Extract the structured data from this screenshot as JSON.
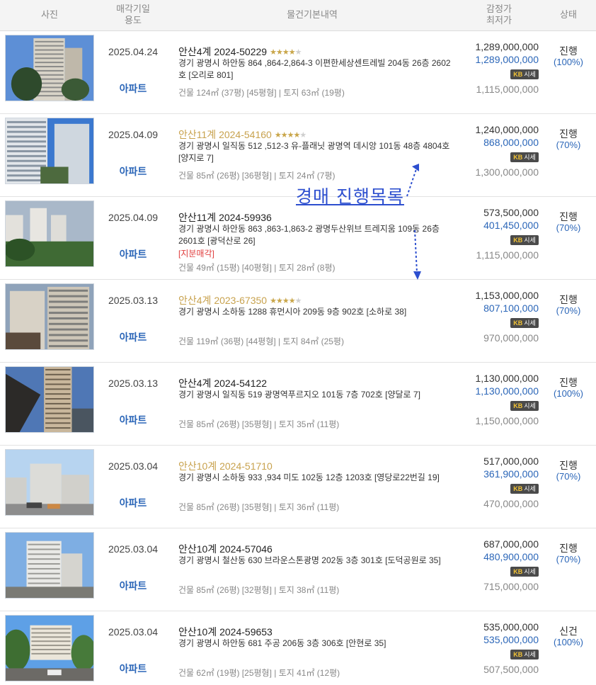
{
  "header": {
    "photo": "사진",
    "date_line1": "매각기일",
    "date_line2": "용도",
    "info": "물건기본내역",
    "price_line1": "감정가",
    "price_line2": "최저가",
    "status": "상태"
  },
  "overlay": {
    "text": "경매 진행목록",
    "color": "#2d4fcf"
  },
  "colors": {
    "gold_case": "#c8a24e",
    "blue": "#2b66b8",
    "header_bg": "#f4f4f4"
  },
  "badge": {
    "kb": "KB",
    "label": "시세"
  },
  "rows": [
    {
      "date": "2025.04.24",
      "use": "아파트",
      "case": "안산4계 2024-50229",
      "case_gold": false,
      "stars": 4,
      "addr": "경기 광명시 하안동 864 ,864-2,864-3 이편한세상센트레빌 204동 26층 2602호 [오리로 801]",
      "tag": "",
      "area": "건물 124㎡ (37평) [45평형]  |  토지 63㎡ (19평)",
      "appraisal": "1,289,000,000",
      "minimum": "1,289,000,000",
      "last": "1,115,000,000",
      "status": "진행",
      "percent": "(100%)",
      "photo": "tower-tall"
    },
    {
      "date": "2025.04.09",
      "use": "아파트",
      "case": "안산11계 2024-54160",
      "case_gold": true,
      "stars": 4,
      "addr": "경기 광명시 일직동 512 ,512-3 유-플래닛 광명역 데시앙 101동 48층 4804호 [양지로 7]",
      "tag": "",
      "area": "건물 85㎡ (26평) [36평형]  |  토지 24㎡ (7평)",
      "appraisal": "1,240,000,000",
      "minimum": "868,000,000",
      "last": "1,300,000,000",
      "status": "진행",
      "percent": "(70%)",
      "photo": "tower-blue"
    },
    {
      "date": "2025.04.09",
      "use": "아파트",
      "case": "안산11계 2024-59936",
      "case_gold": false,
      "stars": 0,
      "addr": "경기 광명시 하안동 863 ,863-1,863-2 광명두산위브 트레지움 109동 26층 2601호 [광덕산로 26]",
      "tag": "[지분매각]",
      "area": "건물 49㎡ (15평) [40평형]  |  토지 28㎡ (8평)",
      "appraisal": "573,500,000",
      "minimum": "401,450,000",
      "last": "1,115,000,000",
      "status": "진행",
      "percent": "(70%)",
      "photo": "green-complex"
    },
    {
      "date": "2025.03.13",
      "use": "아파트",
      "case": "안산4계 2023-67350",
      "case_gold": true,
      "stars": 4,
      "addr": "경기 광명시 소하동 1288 휴먼시아 209동 9층 902호 [소하로 38]",
      "tag": "",
      "area": "건물 119㎡ (36평) [44평형]  |  토지 84㎡ (25평)",
      "appraisal": "1,153,000,000",
      "minimum": "807,100,000",
      "last": "970,000,000",
      "status": "진행",
      "percent": "(70%)",
      "photo": "winter"
    },
    {
      "date": "2025.03.13",
      "use": "아파트",
      "case": "안산4계 2024-54122",
      "case_gold": false,
      "stars": 0,
      "addr": "경기 광명시 일직동 519 광명역푸르지오 101동 7층 702호 [양달로 7]",
      "tag": "",
      "area": "건물 85㎡ (26평) [35평형]  |  토지 35㎡ (11평)",
      "appraisal": "1,130,000,000",
      "minimum": "1,130,000,000",
      "last": "1,150,000,000",
      "status": "진행",
      "percent": "(100%)",
      "photo": "tower-dark"
    },
    {
      "date": "2025.03.04",
      "use": "아파트",
      "case": "안산10계 2024-51710",
      "case_gold": true,
      "stars": 0,
      "addr": "경기 광명시 소하동 933 ,934 미도 102동 12층 1203호 [영당로22번길 19]",
      "tag": "",
      "area": "건물 85㎡ (26평) [35평형]  |  토지 36㎡ (11평)",
      "appraisal": "517,000,000",
      "minimum": "361,900,000",
      "last": "470,000,000",
      "status": "진행",
      "percent": "(70%)",
      "photo": "street"
    },
    {
      "date": "2025.03.04",
      "use": "아파트",
      "case": "안산10계 2024-57046",
      "case_gold": false,
      "stars": 0,
      "addr": "경기 광명시 철산동 630 브라운스톤광명 202동 3층 301호 [도덕공원로 35]",
      "tag": "",
      "area": "건물 85㎡ (26평) [32평형]  |  토지 38㎡ (11평)",
      "appraisal": "687,000,000",
      "minimum": "480,900,000",
      "last": "715,000,000",
      "status": "진행",
      "percent": "(70%)",
      "photo": "tower-sky"
    },
    {
      "date": "2025.03.04",
      "use": "아파트",
      "case": "안산10계 2024-59653",
      "case_gold": false,
      "stars": 0,
      "addr": "경기 광명시 하안동 681 주공 206동 3층 306호 [안현로 35]",
      "tag": "",
      "area": "건물 62㎡ (19평) [25평형]  |  토지 41㎡ (12평)",
      "appraisal": "535,000,000",
      "minimum": "535,000,000",
      "last": "507,500,000",
      "status": "신건",
      "percent": "(100%)",
      "photo": "parking"
    }
  ]
}
